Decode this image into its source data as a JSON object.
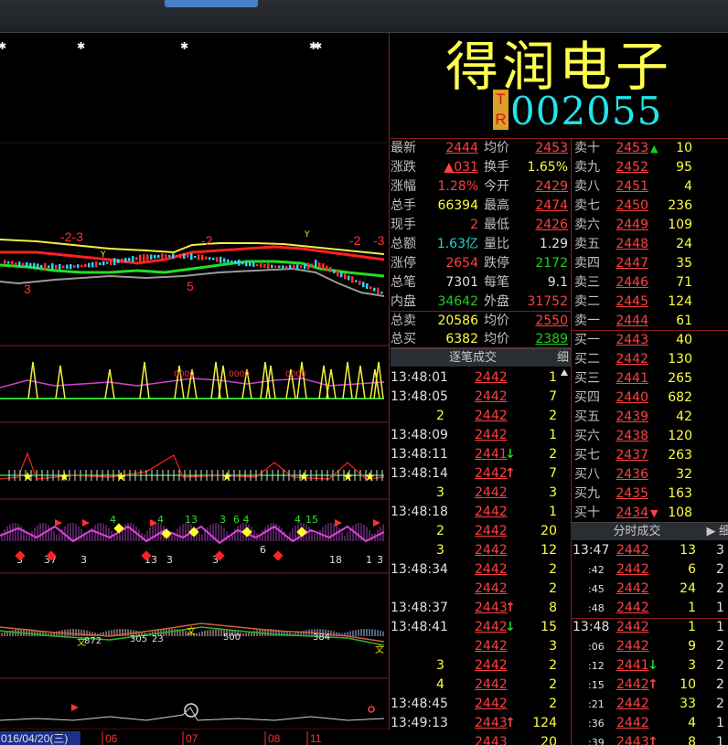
{
  "stock": {
    "name": "得润电子",
    "badge": [
      "T",
      "R"
    ],
    "code": "002055"
  },
  "quote_left": [
    {
      "label": "最新",
      "value": "2444",
      "color": "red",
      "u": true
    },
    {
      "label": "涨跌",
      "value": "▲031",
      "color": "red",
      "u": true
    },
    {
      "label": "涨幅",
      "value": "1.28%",
      "color": "red",
      "u": false
    },
    {
      "label": "总手",
      "value": "66394",
      "color": "yel",
      "u": false
    },
    {
      "label": "现手",
      "value": "2",
      "color": "red",
      "u": false
    },
    {
      "label": "总额",
      "value": "1.63亿",
      "color": "cy",
      "u": false
    },
    {
      "label": "涨停",
      "value": "2654",
      "color": "red",
      "u": false
    },
    {
      "label": "总笔",
      "value": "7301",
      "color": "wht",
      "u": false
    },
    {
      "label": "内盘",
      "value": "34642",
      "color": "grn",
      "u": false
    }
  ],
  "quote_mid": [
    {
      "label": "均价",
      "value": "2453",
      "color": "red",
      "u": true
    },
    {
      "label": "换手",
      "value": "1.65%",
      "color": "yel",
      "u": false
    },
    {
      "label": "今开",
      "value": "2429",
      "color": "red",
      "u": true
    },
    {
      "label": "最高",
      "value": "2474",
      "color": "red",
      "u": true
    },
    {
      "label": "最低",
      "value": "2426",
      "color": "red",
      "u": true
    },
    {
      "label": "量比",
      "value": "1.29",
      "color": "wht",
      "u": false
    },
    {
      "label": "跌停",
      "value": "2172",
      "color": "grn",
      "u": false
    },
    {
      "label": "每笔",
      "value": "9.1",
      "color": "wht",
      "u": false
    },
    {
      "label": "外盘",
      "value": "31752",
      "color": "red",
      "u": false
    }
  ],
  "totals": [
    {
      "label": "总卖",
      "value": "20586",
      "color": "yel",
      "label2": "均价",
      "value2": "2550",
      "color2": "red"
    },
    {
      "label": "总买",
      "value": "6382",
      "color": "yel",
      "label2": "均价",
      "value2": "2389",
      "color2": "grn"
    }
  ],
  "order_book": [
    {
      "label": "卖十",
      "price": "2453",
      "vol": "10",
      "arrow": "▲"
    },
    {
      "label": "卖九",
      "price": "2452",
      "vol": "95",
      "arrow": ""
    },
    {
      "label": "卖八",
      "price": "2451",
      "vol": "4",
      "arrow": ""
    },
    {
      "label": "卖七",
      "price": "2450",
      "vol": "236",
      "arrow": ""
    },
    {
      "label": "卖六",
      "price": "2449",
      "vol": "109",
      "arrow": ""
    },
    {
      "label": "卖五",
      "price": "2448",
      "vol": "24",
      "arrow": ""
    },
    {
      "label": "卖四",
      "price": "2447",
      "vol": "35",
      "arrow": ""
    },
    {
      "label": "卖三",
      "price": "2446",
      "vol": "71",
      "arrow": ""
    },
    {
      "label": "卖二",
      "price": "2445",
      "vol": "124",
      "arrow": ""
    },
    {
      "label": "卖一",
      "price": "2444",
      "vol": "61",
      "arrow": ""
    },
    {
      "label": "买一",
      "price": "2443",
      "vol": "40",
      "arrow": ""
    },
    {
      "label": "买二",
      "price": "2442",
      "vol": "130",
      "arrow": ""
    },
    {
      "label": "买三",
      "price": "2441",
      "vol": "265",
      "arrow": ""
    },
    {
      "label": "买四",
      "price": "2440",
      "vol": "682",
      "arrow": ""
    },
    {
      "label": "买五",
      "price": "2439",
      "vol": "42",
      "arrow": ""
    },
    {
      "label": "买六",
      "price": "2438",
      "vol": "120",
      "arrow": ""
    },
    {
      "label": "买七",
      "price": "2437",
      "vol": "263",
      "arrow": ""
    },
    {
      "label": "买八",
      "price": "2436",
      "vol": "32",
      "arrow": ""
    },
    {
      "label": "买九",
      "price": "2435",
      "vol": "163",
      "arrow": ""
    },
    {
      "label": "买十",
      "price": "2434",
      "vol": "108",
      "arrow": "▼"
    }
  ],
  "trades_header": {
    "title": "逐笔成交",
    "tab": "细"
  },
  "trades": [
    {
      "time": "13:48:01",
      "price": "2442",
      "arrow": "",
      "vol": "1"
    },
    {
      "time": "13:48:05",
      "price": "2442",
      "arrow": "",
      "vol": "7"
    },
    {
      "time": "",
      "price": "2442",
      "arrow": "",
      "vol": "2"
    },
    {
      "time": "13:48:09",
      "price": "2442",
      "arrow": "",
      "vol": "1"
    },
    {
      "time": "13:48:11",
      "price": "2441",
      "arrow": "↓",
      "vol": "2"
    },
    {
      "time": "13:48:14",
      "price": "2442",
      "arrow": "↑",
      "vol": "7"
    },
    {
      "time": "",
      "price": "2442",
      "arrow": "",
      "vol": "3"
    },
    {
      "time": "13:48:18",
      "price": "2442",
      "arrow": "",
      "vol": "1"
    },
    {
      "time": "",
      "price": "2442",
      "arrow": "",
      "vol": "20"
    },
    {
      "time": "",
      "price": "2442",
      "arrow": "",
      "vol": "12"
    },
    {
      "time": "13:48:34",
      "price": "2442",
      "arrow": "",
      "vol": "2"
    },
    {
      "time": "",
      "price": "2442",
      "arrow": "",
      "vol": "2"
    },
    {
      "time": "13:48:37",
      "price": "2443",
      "arrow": "↑",
      "vol": "8"
    },
    {
      "time": "13:48:41",
      "price": "2442",
      "arrow": "↓",
      "vol": "15"
    },
    {
      "time": "",
      "price": "2442",
      "arrow": "",
      "vol": "3"
    },
    {
      "time": "",
      "price": "2442",
      "arrow": "",
      "vol": "2"
    },
    {
      "time": "",
      "price": "2442",
      "arrow": "",
      "vol": "2"
    },
    {
      "time": "13:48:45",
      "price": "2442",
      "arrow": "",
      "vol": "2"
    },
    {
      "time": "13:49:13",
      "price": "2443",
      "arrow": "↑",
      "vol": "124"
    },
    {
      "time": "",
      "price": "2443",
      "arrow": "",
      "vol": "20"
    }
  ],
  "trade_counts": [
    "",
    "",
    "2",
    "",
    "",
    "",
    "3",
    "",
    "2",
    "3",
    "",
    "",
    "",
    "",
    "",
    "3",
    "4",
    "",
    "",
    ""
  ],
  "minute_header": {
    "title": "分时成交",
    "tab": "细"
  },
  "minute_trades": [
    {
      "time": "13:47",
      "price": "2442",
      "arrow": "",
      "vol": "13",
      "n": "3"
    },
    {
      "time": ":42",
      "price": "2442",
      "arrow": "",
      "vol": "6",
      "n": "2"
    },
    {
      "time": ":45",
      "price": "2442",
      "arrow": "",
      "vol": "24",
      "n": "2"
    },
    {
      "time": ":48",
      "price": "2442",
      "arrow": "",
      "vol": "1",
      "n": "1"
    },
    {
      "time": "13:48",
      "price": "2442",
      "arrow": "",
      "vol": "1",
      "n": "1"
    },
    {
      "time": ":06",
      "price": "2442",
      "arrow": "",
      "vol": "9",
      "n": "2"
    },
    {
      "time": ":12",
      "price": "2441",
      "arrow": "↓",
      "vol": "3",
      "n": "2"
    },
    {
      "time": ":15",
      "price": "2442",
      "arrow": "↑",
      "vol": "10",
      "n": "2"
    },
    {
      "time": ":21",
      "price": "2442",
      "arrow": "",
      "vol": "33",
      "n": "2"
    },
    {
      "time": ":36",
      "price": "2442",
      "arrow": "",
      "vol": "4",
      "n": "1"
    },
    {
      "time": ":39",
      "price": "2443",
      "arrow": "↑",
      "vol": "8",
      "n": "1"
    }
  ],
  "chart": {
    "date_label": "016/04/20(三)",
    "months": [
      "06",
      "07",
      "08",
      "11"
    ],
    "annotations": [
      "-2-3",
      "-2",
      "-2",
      "-3",
      "3",
      "5",
      "Y",
      "Y"
    ],
    "pane4_labels": [
      "4",
      "4",
      "13",
      "3",
      "6 4",
      "4",
      "15",
      "3",
      "37",
      "3",
      "13",
      "3",
      "3",
      "6",
      "18",
      "1",
      "3"
    ],
    "pane5_labels": [
      "872",
      "305",
      "23",
      "500",
      "384"
    ]
  }
}
